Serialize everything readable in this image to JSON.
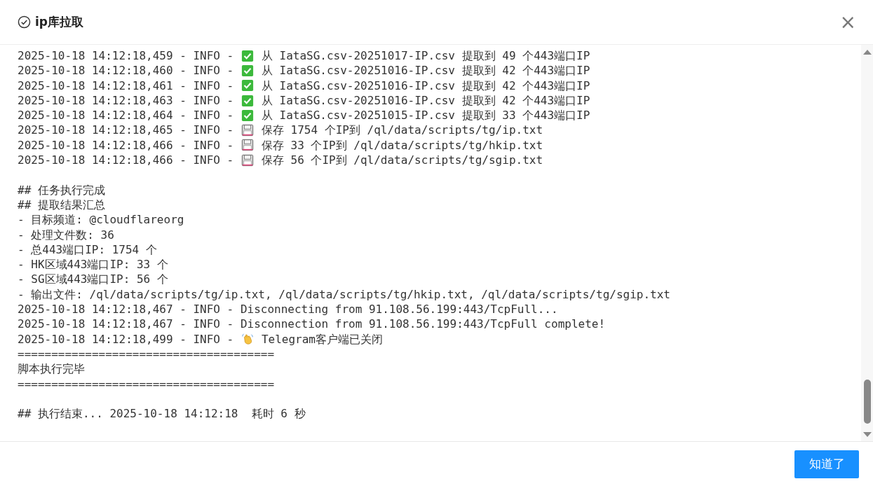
{
  "dialog": {
    "title": "ip库拉取",
    "close_symbol": "×"
  },
  "log_blocks": [
    [
      {
        "kind": "success",
        "prefix": "2025-10-18 14:12:18,459 - INFO - ",
        "text": "从 IataSG.csv-20251017-IP.csv 提取到 49 个443端口IP"
      },
      {
        "kind": "success",
        "prefix": "2025-10-18 14:12:18,460 - INFO - ",
        "text": "从 IataSG.csv-20251016-IP.csv 提取到 42 个443端口IP"
      },
      {
        "kind": "success",
        "prefix": "2025-10-18 14:12:18,461 - INFO - ",
        "text": "从 IataSG.csv-20251016-IP.csv 提取到 42 个443端口IP"
      },
      {
        "kind": "success",
        "prefix": "2025-10-18 14:12:18,463 - INFO - ",
        "text": "从 IataSG.csv-20251016-IP.csv 提取到 42 个443端口IP"
      },
      {
        "kind": "success",
        "prefix": "2025-10-18 14:12:18,464 - INFO - ",
        "text": "从 IataSG.csv-20251015-IP.csv 提取到 33 个443端口IP"
      },
      {
        "kind": "save",
        "prefix": "2025-10-18 14:12:18,465 - INFO - ",
        "text": "保存 1754 个IP到 /ql/data/scripts/tg/ip.txt"
      },
      {
        "kind": "save",
        "prefix": "2025-10-18 14:12:18,466 - INFO - ",
        "text": "保存 33 个IP到 /ql/data/scripts/tg/hkip.txt"
      },
      {
        "kind": "save",
        "prefix": "2025-10-18 14:12:18,466 - INFO - ",
        "text": "保存 56 个IP到 /ql/data/scripts/tg/sgip.txt"
      }
    ],
    [
      {
        "kind": "plain",
        "text": "## 任务执行完成"
      },
      {
        "kind": "plain",
        "text": "## 提取结果汇总"
      },
      {
        "kind": "plain",
        "text": "- 目标频道: @cloudflareorg"
      },
      {
        "kind": "plain",
        "text": "- 处理文件数: 36"
      },
      {
        "kind": "plain",
        "text": "- 总443端口IP: 1754 个"
      },
      {
        "kind": "plain",
        "text": "- HK区域443端口IP: 33 个"
      },
      {
        "kind": "plain",
        "text": "- SG区域443端口IP: 56 个"
      },
      {
        "kind": "plain",
        "text": "- 输出文件: /ql/data/scripts/tg/ip.txt, /ql/data/scripts/tg/hkip.txt, /ql/data/scripts/tg/sgip.txt"
      },
      {
        "kind": "plain",
        "text": "2025-10-18 14:12:18,467 - INFO - Disconnecting from 91.108.56.199:443/TcpFull..."
      },
      {
        "kind": "plain",
        "text": "2025-10-18 14:12:18,467 - INFO - Disconnection from 91.108.56.199:443/TcpFull complete!"
      },
      {
        "kind": "farewell",
        "prefix": "2025-10-18 14:12:18,499 - INFO - ",
        "text": "Telegram客户端已关闭"
      },
      {
        "kind": "plain",
        "text": "======================================"
      },
      {
        "kind": "plain",
        "text": "脚本执行完毕"
      },
      {
        "kind": "plain",
        "text": "======================================"
      }
    ],
    [
      {
        "kind": "plain",
        "text": "## 执行结束... 2025-10-18 14:12:18  耗时 6 秒"
      }
    ]
  ],
  "buttons": [
    {
      "label": "知道了"
    }
  ]
}
